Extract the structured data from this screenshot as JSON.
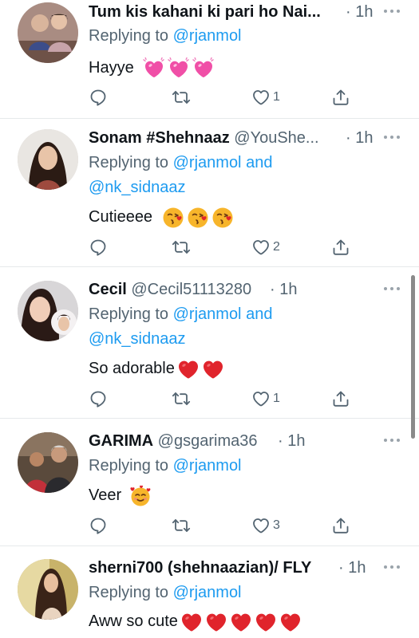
{
  "reply_prefix": "Replying to",
  "tweets": [
    {
      "name": "Tum kis kahani ki pari ho Nai...",
      "handle": "",
      "time": "1h",
      "reply_to": [
        "@rjanmol"
      ],
      "reply_joiner": "",
      "text": "Hayye",
      "emojis": [
        "pink-heart-emoji",
        "pink-heart-emoji",
        "pink-heart-emoji"
      ],
      "like_count": "1"
    },
    {
      "name": "Sonam #Shehnaaz",
      "handle": "@YouShe...",
      "time": "1h",
      "reply_to": [
        "@rjanmol",
        "@nk_sidnaaz"
      ],
      "reply_joiner": "and",
      "text": "Cutieeee",
      "emojis": [
        "kiss-face-emoji",
        "kiss-face-emoji",
        "kiss-face-emoji"
      ],
      "like_count": "2"
    },
    {
      "name": "Cecil",
      "handle": "@Cecil51113280",
      "time": "1h",
      "reply_to": [
        "@rjanmol",
        "@nk_sidnaaz"
      ],
      "reply_joiner": "and",
      "text": "So adorable",
      "emojis": [
        "red-heart-emoji",
        "red-heart-emoji"
      ],
      "like_count": "1"
    },
    {
      "name": "GARIMA",
      "handle": "@gsgarima36",
      "time": "1h",
      "reply_to": [
        "@rjanmol"
      ],
      "reply_joiner": "",
      "text": "Veer",
      "emojis": [
        "smiling-face-hearts-emoji"
      ],
      "like_count": "3"
    },
    {
      "name": "sherni700 (shehnaazian)/ FLY",
      "handle": "",
      "time": "1h",
      "reply_to": [
        "@rjanmol"
      ],
      "reply_joiner": "",
      "text": "Aww so cute",
      "emojis": [
        "red-heart-emoji",
        "red-heart-emoji",
        "red-heart-emoji",
        "red-heart-emoji",
        "red-heart-emoji"
      ],
      "like_count": ""
    }
  ],
  "colors": {
    "link": "#1d9bf0",
    "muted": "#536471",
    "divider": "#e6e9eb"
  },
  "icons": {
    "reply": "speech-bubble-icon",
    "retweet": "retweet-arrows-icon",
    "like": "heart-outline-icon",
    "share": "share-upload-icon",
    "more": "ellipsis-icon"
  }
}
